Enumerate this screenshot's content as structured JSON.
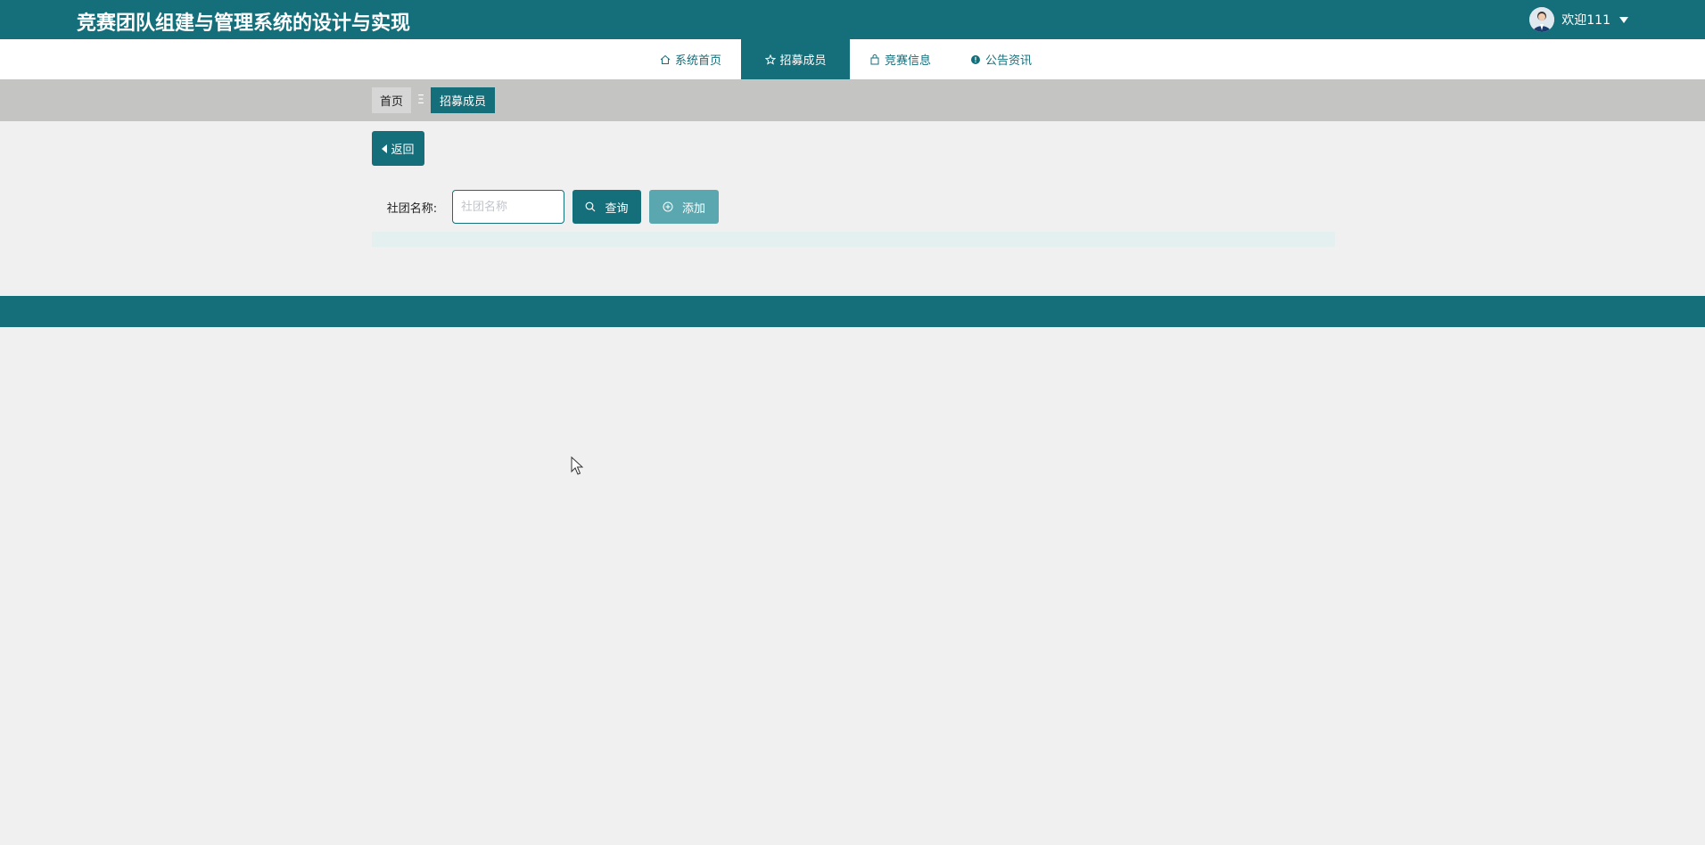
{
  "header": {
    "title": "竞赛团队组建与管理系统的设计与实现",
    "welcome": "欢迎111"
  },
  "nav": {
    "items": [
      {
        "label": "系统首页",
        "icon": "home-icon"
      },
      {
        "label": "招募成员",
        "icon": "star-icon",
        "active": true
      },
      {
        "label": "竞赛信息",
        "icon": "bag-icon"
      },
      {
        "label": "公告资讯",
        "icon": "info-circle-icon"
      }
    ]
  },
  "breadcrumb": {
    "home": "首页",
    "separator": "Ξ",
    "current": "招募成员"
  },
  "actions": {
    "back_label": "返回"
  },
  "search": {
    "label": "社团名称:",
    "placeholder": "社团名称",
    "value": "",
    "query_label": "查询",
    "add_label": "添加"
  },
  "colors": {
    "primary": "#156f7b",
    "primary_light": "#5aa7b0",
    "breadcrumb_bg": "#c4c4c3",
    "page_bg": "#f0f0f0"
  }
}
